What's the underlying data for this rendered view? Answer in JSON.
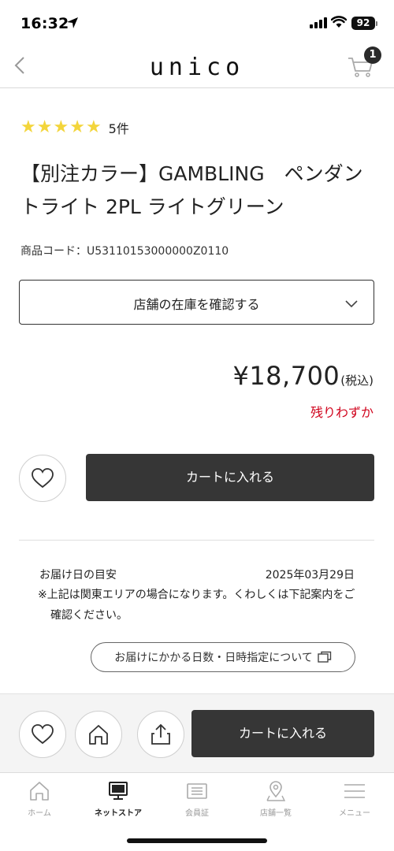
{
  "status_bar": {
    "time": "16:32",
    "battery": "92"
  },
  "header": {
    "logo": "unico",
    "cart_count": "1"
  },
  "product": {
    "star_count": 5,
    "review_count": "5件",
    "title": "【別注カラー】GAMBLING　ペンダントライト 2PL ライトグリーン",
    "code": "商品コード：U53110153000000Z0110",
    "store_stock_label": "店舗の在庫を確認する",
    "price": "¥18,700",
    "tax_label": "(税込)",
    "stock_status": "残りわずか",
    "add_to_cart_label": "カートに入れる"
  },
  "delivery": {
    "label": "お届け日の目安",
    "date": "2025年03月29日",
    "note": "※上記は関東エリアの場合になります。くわしくは下記案内をご確認ください。",
    "link_label": "お届けにかかる日数・日時指定について"
  },
  "sticky_bar": {
    "add_to_cart_label": "カートに入れる"
  },
  "tabs": [
    {
      "label": "ホーム",
      "icon": "home-icon",
      "active": false
    },
    {
      "label": "ネットストア",
      "icon": "monitor-icon",
      "active": true
    },
    {
      "label": "会員証",
      "icon": "member-card-icon",
      "active": false
    },
    {
      "label": "店舗一覧",
      "icon": "map-pin-icon",
      "active": false
    },
    {
      "label": "メニュー",
      "icon": "menu-icon",
      "active": false
    }
  ],
  "colors": {
    "accent": "#363636",
    "star": "#f3d53b",
    "alert": "#d0021b"
  }
}
